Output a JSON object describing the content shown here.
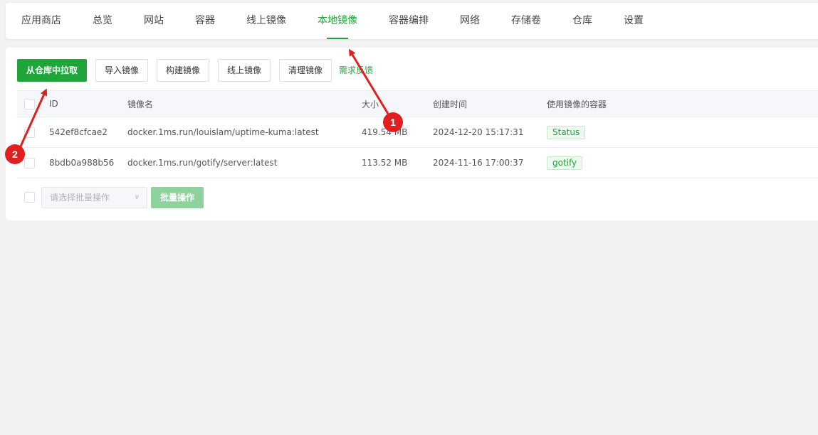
{
  "tabs": [
    {
      "label": "应用商店",
      "active": false
    },
    {
      "label": "总览",
      "active": false
    },
    {
      "label": "网站",
      "active": false
    },
    {
      "label": "容器",
      "active": false
    },
    {
      "label": "线上镜像",
      "active": false
    },
    {
      "label": "本地镜像",
      "active": true
    },
    {
      "label": "容器编排",
      "active": false
    },
    {
      "label": "网络",
      "active": false
    },
    {
      "label": "存储卷",
      "active": false
    },
    {
      "label": "仓库",
      "active": false
    },
    {
      "label": "设置",
      "active": false
    }
  ],
  "toolbar": {
    "pull_label": "从仓库中拉取",
    "import_label": "导入镜像",
    "build_label": "构建镜像",
    "online_label": "线上镜像",
    "clean_label": "清理镜像",
    "feedback_label": "需求反馈"
  },
  "table": {
    "columns": {
      "id": "ID",
      "name": "镜像名",
      "size": "大小",
      "created": "创建时间",
      "containers": "使用镜像的容器"
    },
    "rows": [
      {
        "id": "542ef8cfcae2",
        "name": "docker.1ms.run/louislam/uptime-kuma:latest",
        "size": "419.54 MB",
        "created": "2024-12-20 15:17:31",
        "container": "Status"
      },
      {
        "id": "8bdb0a988b56",
        "name": "docker.1ms.run/gotify/server:latest",
        "size": "113.52 MB",
        "created": "2024-11-16 17:00:37",
        "container": "gotify"
      }
    ]
  },
  "batch": {
    "select_placeholder": "请选择批量操作",
    "button_label": "批量操作"
  },
  "annotations": {
    "badge_1": "1",
    "badge_2": "2"
  },
  "colors": {
    "accent": "#20a53a",
    "annotation": "#e02020"
  }
}
